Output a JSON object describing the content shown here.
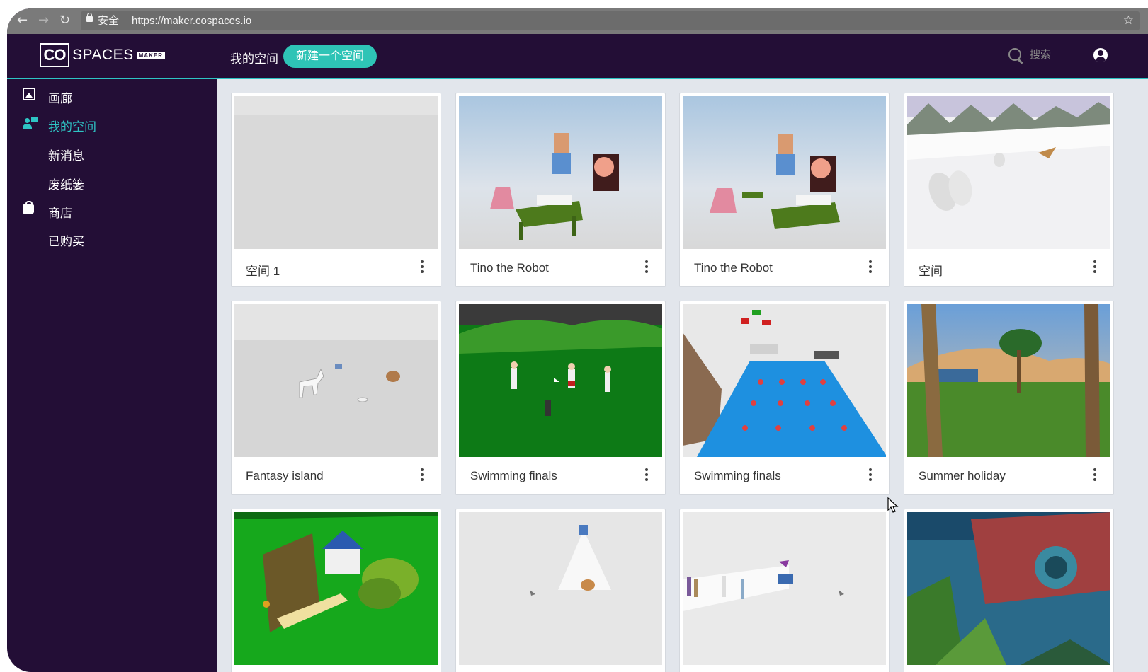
{
  "browser": {
    "secure_label": "安全",
    "url": "https://maker.cospaces.io",
    "back_icon": "arrow-left-icon",
    "forward_icon": "arrow-right-icon",
    "reload_icon": "reload-icon",
    "bookmark_icon": "star-icon"
  },
  "header": {
    "logo_co": "CO",
    "logo_spaces": "SPACES",
    "logo_maker": "MAKER",
    "my_spaces": "我的空间",
    "new_space": "新建一个空间",
    "search_placeholder": "搜索",
    "accent_color": "#2ec4c4",
    "background_color": "#230e36"
  },
  "sidebar": {
    "items": [
      {
        "label": "画廊",
        "icon": "gallery-icon",
        "active": false
      },
      {
        "label": "我的空间",
        "icon": "people-icon",
        "active": true
      },
      {
        "label": "新消息",
        "icon": "",
        "active": false
      },
      {
        "label": "废纸篓",
        "icon": "",
        "active": false
      },
      {
        "label": "商店",
        "icon": "shopping-bag-icon",
        "active": false
      },
      {
        "label": "已购买",
        "icon": "",
        "active": false
      }
    ]
  },
  "cards": [
    {
      "title": "空间 1",
      "scene": "empty"
    },
    {
      "title": "Tino the Robot",
      "scene": "robot"
    },
    {
      "title": "Tino the Robot",
      "scene": "robot"
    },
    {
      "title": "空间",
      "scene": "snow"
    },
    {
      "title": "Fantasy island",
      "scene": "horse"
    },
    {
      "title": "Swimming finals",
      "scene": "grass"
    },
    {
      "title": "Swimming finals",
      "scene": "pool"
    },
    {
      "title": "Summer holiday",
      "scene": "desert"
    },
    {
      "title": "",
      "scene": "farm"
    },
    {
      "title": "",
      "scene": "camera-lion"
    },
    {
      "title": "",
      "scene": "camera-people"
    },
    {
      "title": "",
      "scene": "mural"
    }
  ]
}
